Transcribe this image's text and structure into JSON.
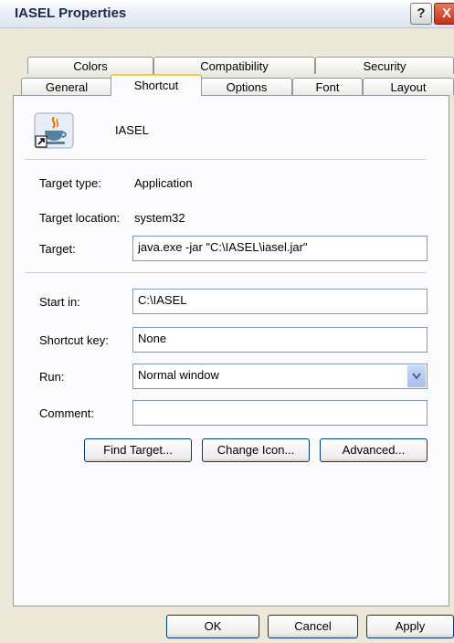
{
  "window": {
    "title": "IASEL Properties",
    "help_label": "?",
    "close_label": "X"
  },
  "tabs_row1": [
    "Colors",
    "Compatibility",
    "Security"
  ],
  "tabs_row2": [
    "General",
    "Shortcut",
    "Options",
    "Font",
    "Layout"
  ],
  "active_tab": "Shortcut",
  "shortcut": {
    "name": "IASEL",
    "target_type_label": "Target type:",
    "target_type_value": "Application",
    "target_location_label": "Target location:",
    "target_location_value": "system32",
    "target_label": "Target:",
    "target_value": "java.exe -jar \"C:\\IASEL\\iasel.jar\"",
    "start_in_label": "Start in:",
    "start_in_value": "C:\\IASEL",
    "shortcut_key_label": "Shortcut key:",
    "shortcut_key_value": "None",
    "run_label": "Run:",
    "run_value": "Normal window",
    "comment_label": "Comment:",
    "comment_value": ""
  },
  "buttons": {
    "find_target": "Find Target...",
    "change_icon": "Change Icon...",
    "advanced": "Advanced...",
    "ok": "OK",
    "cancel": "Cancel",
    "apply": "Apply"
  },
  "icons": {
    "app_icon": "java-coffee-cup-icon",
    "shortcut_overlay": "shortcut-arrow-icon",
    "dropdown": "chevron-down-icon"
  }
}
